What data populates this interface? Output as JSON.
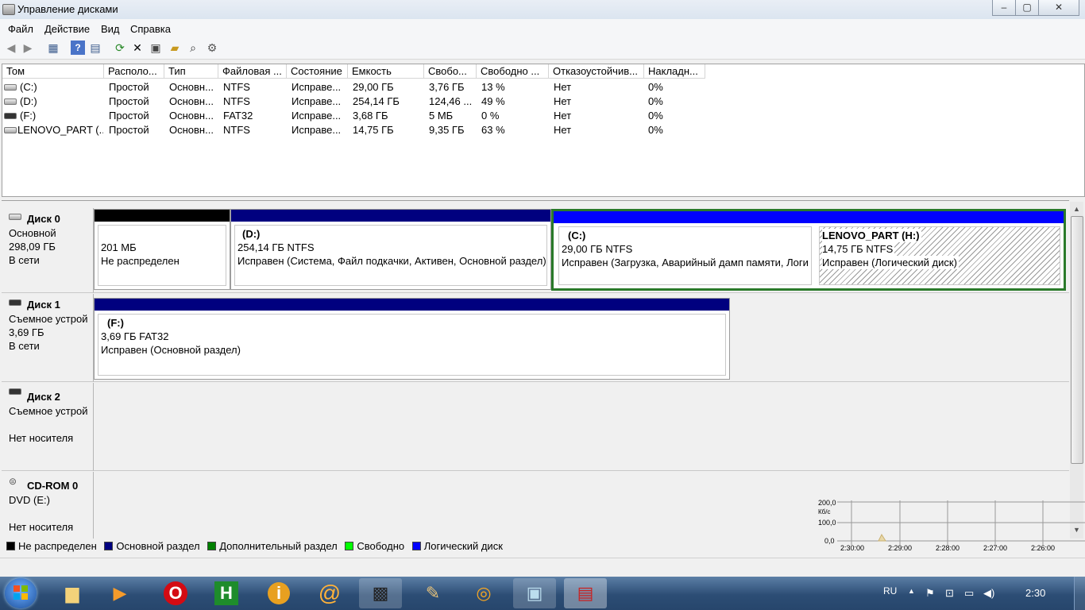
{
  "window": {
    "title": "Управление дисками",
    "min": "–",
    "max": "▢",
    "close": "✕"
  },
  "menu": [
    "Файл",
    "Действие",
    "Вид",
    "Справка"
  ],
  "toolbar_icons": [
    "back-icon",
    "forward-icon",
    "properties-grid-icon",
    "help-icon",
    "console-icon",
    "refresh-icon",
    "delete-icon",
    "properties-icon",
    "open-icon",
    "search-icon",
    "settings-icon"
  ],
  "list": {
    "columns": [
      "Том",
      "Располо...",
      "Тип",
      "Файловая ...",
      "Состояние",
      "Емкость",
      "Свобо...",
      "Свободно ...",
      "Отказоустойчив...",
      "Накладн..."
    ],
    "rows": [
      [
        "(C:)",
        "Простой",
        "Основн...",
        "NTFS",
        "Исправе...",
        "29,00 ГБ",
        "3,76 ГБ",
        "13 %",
        "Нет",
        "0%"
      ],
      [
        "(D:)",
        "Простой",
        "Основн...",
        "NTFS",
        "Исправе...",
        "254,14 ГБ",
        "124,46 ...",
        "49 %",
        "Нет",
        "0%"
      ],
      [
        "(F:)",
        "Простой",
        "Основн...",
        "FAT32",
        "Исправе...",
        "3,68 ГБ",
        "5 МБ",
        "0 %",
        "Нет",
        "0%"
      ],
      [
        "LENOVO_PART (...",
        "Простой",
        "Основн...",
        "NTFS",
        "Исправе...",
        "14,75 ГБ",
        "9,35 ГБ",
        "63 %",
        "Нет",
        "0%"
      ]
    ]
  },
  "disks": [
    {
      "name": "Диск 0",
      "type": "Основной",
      "size": "298,09 ГБ",
      "status": "В сети",
      "partitions": [
        {
          "label": "",
          "size": "201 МБ",
          "status": "Не распределен",
          "color": "#000000"
        },
        {
          "label": "(D:)",
          "size": "254,14 ГБ NTFS",
          "status": "Исправен (Система, Файл подкачки, Активен, Основной раздел)",
          "color": "#00007f"
        },
        {
          "label": "(C:)",
          "size": "29,00 ГБ NTFS",
          "status": "Исправен (Загрузка, Аварийный дамп памяти, Логи",
          "color": "#0000ff"
        },
        {
          "label": "LENOVO_PART  (H:)",
          "size": "14,75 ГБ NTFS",
          "status": "Исправен (Логический диск)",
          "color": "#0000ff"
        }
      ]
    },
    {
      "name": "Диск 1",
      "type": "Съемное устрой",
      "size": "3,69 ГБ",
      "status": "В сети",
      "partitions": [
        {
          "label": "(F:)",
          "size": "3,69 ГБ FAT32",
          "status": "Исправен (Основной раздел)",
          "color": "#00007f"
        }
      ]
    },
    {
      "name": "Диск 2",
      "type": "Съемное устрой",
      "size": "",
      "status": "Нет носителя",
      "partitions": []
    },
    {
      "name": "CD-ROM 0",
      "type": "DVD (E:)",
      "size": "",
      "status": "Нет носителя",
      "partitions": []
    }
  ],
  "legend": [
    {
      "label": "Не распределен",
      "color": "#000000"
    },
    {
      "label": "Основной раздел",
      "color": "#00007f"
    },
    {
      "label": "Дополнительный раздел",
      "color": "#008000"
    },
    {
      "label": "Свободно",
      "color": "#00ff00"
    },
    {
      "label": "Логический диск",
      "color": "#0000ff"
    }
  ],
  "perf_graph": {
    "y_labels": [
      "200,0",
      "Кб/с",
      "100,0",
      "0,0"
    ],
    "x_labels": [
      "2:30:00",
      "2:29:00",
      "2:28:00",
      "2:27:00",
      "2:26:00"
    ]
  },
  "taskbar": {
    "apps": [
      "start-orb",
      "file-explorer",
      "media-player",
      "opera",
      "app-h",
      "info",
      "at-sign",
      "film-projector",
      "paint",
      "network-app",
      "remote-desktop",
      "toolbox"
    ],
    "lang": "RU",
    "clock": "2:30"
  }
}
